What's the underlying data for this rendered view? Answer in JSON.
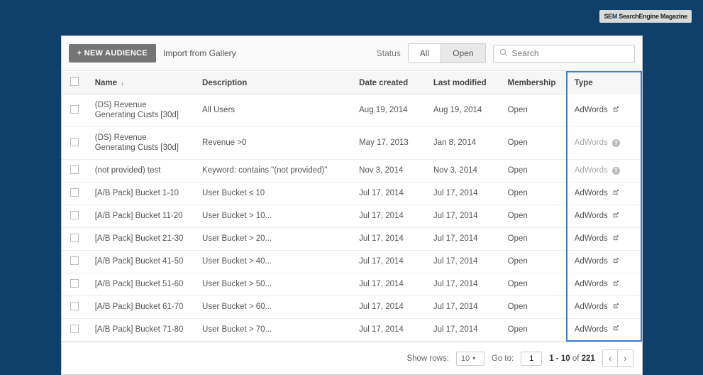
{
  "badge": {
    "prefix": "SE",
    "suffix": "M",
    "rest": " SearchEngine Magazine"
  },
  "toolbar": {
    "new_label": "+ NEW AUDIENCE",
    "import_label": "Import from Gallery",
    "status_label": "Status",
    "seg_all": "All",
    "seg_open": "Open",
    "search_placeholder": "Search"
  },
  "headers": {
    "name": "Name",
    "desc": "Description",
    "date": "Date created",
    "mod": "Last modified",
    "mem": "Membership",
    "type": "Type"
  },
  "rows": [
    {
      "name": "(DS) Revenue Generating Custs [30d]",
      "desc": "All Users",
      "date": "Aug 19, 2014",
      "mod": "Aug 19, 2014",
      "mem": "Open",
      "type": "AdWords",
      "muted": false,
      "ext": true,
      "info": false
    },
    {
      "name": "(DS) Revenue Generating Custs [30d]",
      "desc": "Revenue >0",
      "date": "May 17, 2013",
      "mod": "Jan 8, 2014",
      "mem": "Open",
      "type": "AdWords",
      "muted": true,
      "ext": false,
      "info": true
    },
    {
      "name": "(not provided) test",
      "desc": "Keyword: contains \"(not provided)\"",
      "date": "Nov 3, 2014",
      "mod": "Nov 3, 2014",
      "mem": "Open",
      "type": "AdWords",
      "muted": true,
      "ext": false,
      "info": true
    },
    {
      "name": "[A/B Pack] Bucket 1-10",
      "desc": "User Bucket ≤ 10",
      "date": "Jul 17, 2014",
      "mod": "Jul 17, 2014",
      "mem": "Open",
      "type": "AdWords",
      "muted": false,
      "ext": true,
      "info": false
    },
    {
      "name": "[A/B Pack] Bucket 11-20",
      "desc": "User Bucket > 10...",
      "date": "Jul 17, 2014",
      "mod": "Jul 17, 2014",
      "mem": "Open",
      "type": "AdWords",
      "muted": false,
      "ext": true,
      "info": false
    },
    {
      "name": "[A/B Pack] Bucket 21-30",
      "desc": "User Bucket > 20...",
      "date": "Jul 17, 2014",
      "mod": "Jul 17, 2014",
      "mem": "Open",
      "type": "AdWords",
      "muted": false,
      "ext": true,
      "info": false
    },
    {
      "name": "[A/B Pack] Bucket 41-50",
      "desc": "User Bucket > 40...",
      "date": "Jul 17, 2014",
      "mod": "Jul 17, 2014",
      "mem": "Open",
      "type": "AdWords",
      "muted": false,
      "ext": true,
      "info": false
    },
    {
      "name": "[A/B Pack] Bucket 51-60",
      "desc": "User Bucket > 50...",
      "date": "Jul 17, 2014",
      "mod": "Jul 17, 2014",
      "mem": "Open",
      "type": "AdWords",
      "muted": false,
      "ext": true,
      "info": false
    },
    {
      "name": "[A/B Pack] Bucket 61-70",
      "desc": "User Bucket > 60...",
      "date": "Jul 17, 2014",
      "mod": "Jul 17, 2014",
      "mem": "Open",
      "type": "AdWords",
      "muted": false,
      "ext": true,
      "info": false
    },
    {
      "name": "[A/B Pack] Bucket 71-80",
      "desc": "User Bucket > 70...",
      "date": "Jul 17, 2014",
      "mod": "Jul 17, 2014",
      "mem": "Open",
      "type": "AdWords",
      "muted": false,
      "ext": true,
      "info": false
    }
  ],
  "footer": {
    "show_rows": "Show rows:",
    "rows_val": "10",
    "goto": "Go to:",
    "goto_val": "1",
    "range_a": "1 - 10",
    "range_of": " of ",
    "range_b": "221"
  }
}
